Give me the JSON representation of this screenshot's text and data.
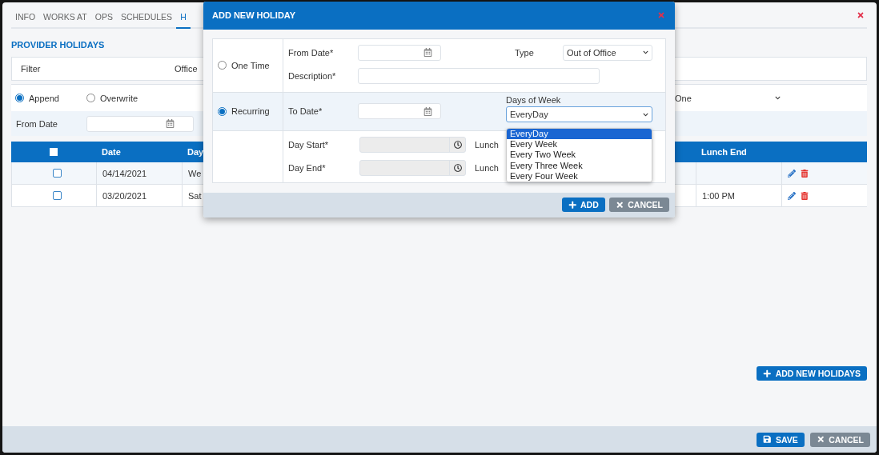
{
  "page": {
    "tabs": [
      {
        "label": "INFO",
        "selected": false
      },
      {
        "label": "WORKS AT",
        "selected": false
      },
      {
        "label": "OPS",
        "selected": false
      },
      {
        "label": "SCHEDULES",
        "selected": false
      },
      {
        "label": "H",
        "selected": true
      }
    ],
    "section_title": "PROVIDER HOLIDAYS",
    "filter": {
      "label": "Filter",
      "office_label": "Office"
    },
    "mode_options": [
      {
        "label": "Append",
        "selected": true
      },
      {
        "label": "Overwrite",
        "selected": false
      }
    ],
    "provider_select": {
      "value": "One"
    },
    "from_date": {
      "label": "From Date"
    },
    "table": {
      "select_all": {
        "checked": false
      },
      "columns": [
        "Date",
        "Day",
        "Lunch End"
      ],
      "rows": [
        {
          "checked": false,
          "date": "04/14/2021",
          "day": "We"
        },
        {
          "checked": false,
          "date": "03/20/2021",
          "day": "Sat",
          "lunch_end": "1:00 PM"
        }
      ]
    },
    "add_button": "ADD NEW HOLIDAYS",
    "footer_buttons": [
      {
        "kind": "save",
        "label": "SAVE"
      },
      {
        "kind": "cancel",
        "label": "CANCEL"
      }
    ]
  },
  "modal": {
    "title": "ADD NEW HOLIDAY",
    "frequency": [
      {
        "label": "One Time",
        "selected": false
      },
      {
        "label": "Recurring",
        "selected": true
      }
    ],
    "from_date_label": "From Date*",
    "type": {
      "label": "Type",
      "value": "Out of Office"
    },
    "description_label": "Description*",
    "to_date_label": "To Date*",
    "days_of_week": {
      "label": "Days of Week",
      "value": "EveryDay",
      "expanded": true,
      "options": [
        {
          "label": "EveryDay",
          "selected": true
        },
        {
          "label": "Every Week",
          "selected": false
        },
        {
          "label": "Every Two Week",
          "selected": false
        },
        {
          "label": "Every Three Week",
          "selected": false
        },
        {
          "label": "Every Four Week",
          "selected": false
        }
      ]
    },
    "day_start": {
      "label": "Day Start*",
      "disabled": true
    },
    "day_end": {
      "label": "Day End*",
      "disabled": true
    },
    "lunch_labels": [
      "Lunch",
      "Lunch"
    ],
    "buttons": [
      {
        "kind": "add",
        "label": "ADD"
      },
      {
        "kind": "cancel",
        "label": "CANCEL"
      }
    ]
  }
}
